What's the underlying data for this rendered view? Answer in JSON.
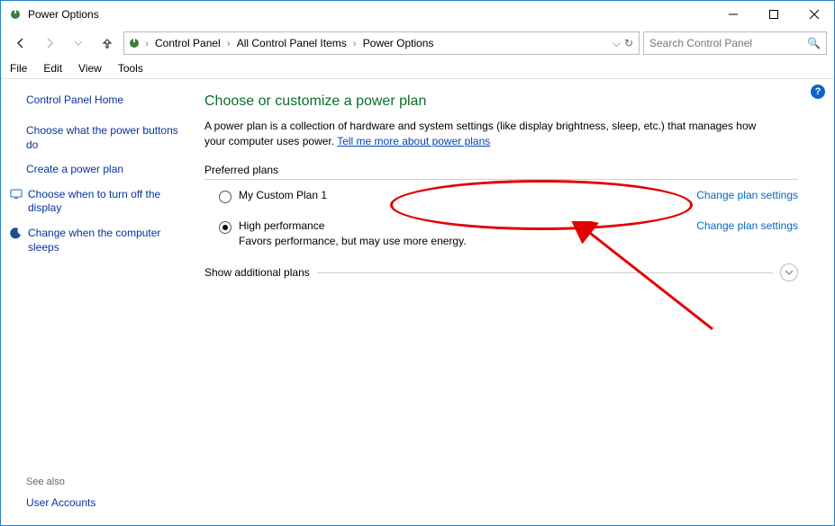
{
  "window": {
    "title": "Power Options"
  },
  "nav": {
    "breadcrumb": [
      "Control Panel",
      "All Control Panel Items",
      "Power Options"
    ],
    "search_placeholder": "Search Control Panel"
  },
  "menu": {
    "items": [
      "File",
      "Edit",
      "View",
      "Tools"
    ]
  },
  "sidebar": {
    "home": "Control Panel Home",
    "links": [
      {
        "label": "Choose what the power buttons do",
        "icon": null
      },
      {
        "label": "Create a power plan",
        "icon": null
      },
      {
        "label": "Choose when to turn off the display",
        "icon": "display-icon"
      },
      {
        "label": "Change when the computer sleeps",
        "icon": "moon-icon"
      }
    ],
    "see_also_label": "See also",
    "see_also": [
      "User Accounts"
    ]
  },
  "main": {
    "heading": "Choose or customize a power plan",
    "description_pre": "A power plan is a collection of hardware and system settings (like display brightness, sleep, etc.) that manages how your computer uses power. ",
    "description_link": "Tell me more about power plans",
    "preferred_label": "Preferred plans",
    "plans": [
      {
        "name": "My Custom Plan 1",
        "desc": "",
        "selected": false,
        "change": "Change plan settings"
      },
      {
        "name": "High performance",
        "desc": "Favors performance, but may use more energy.",
        "selected": true,
        "change": "Change plan settings"
      }
    ],
    "show_additional": "Show additional plans"
  }
}
